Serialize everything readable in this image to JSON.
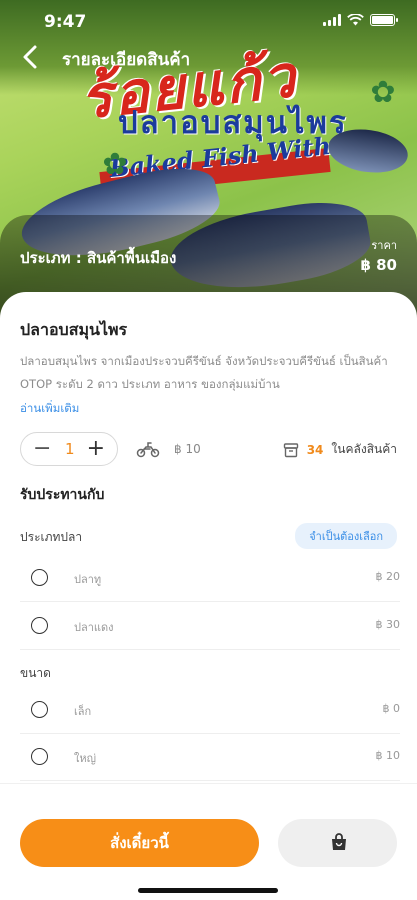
{
  "status_bar": {
    "time": "9:47"
  },
  "nav": {
    "title": "รายละเอียดสินค้า"
  },
  "hero": {
    "brand_text": "ร้อยแก้ว",
    "package_title_th": "ปลาอบสมุนไพร",
    "package_title_en": "Baked Fish With Herbs"
  },
  "category_band": {
    "category": "ประเภท : สินค้าพื้นเมือง",
    "price_label": "ราคา",
    "price": "฿ 80"
  },
  "product": {
    "name": "ปลาอบสมุนไพร",
    "description": "ปลาอบสมุนไพร จากเมืองประจวบคีรีขันธ์ จังหวัดประจวบคีรีขันธ์ เป็นสินค้า OTOP ระดับ 2 ดาว ประเภท อาหาร ของกลุ่มแม่บ้าน",
    "read_more": "อ่านเพิ่มเติม",
    "quantity": "1",
    "delivery_fee": "฿ 10",
    "stock_count": "34",
    "stock_label": "ในคลังสินค้า"
  },
  "options": {
    "section_title": "รับประทานกับ",
    "groups": [
      {
        "label": "ประเภทปลา",
        "badge": "จำเป็นต้องเลือก",
        "items": [
          {
            "name": "ปลาทู",
            "price": "฿ 20"
          },
          {
            "name": "ปลาแดง",
            "price": "฿ 30"
          }
        ]
      },
      {
        "label": "ขนาด",
        "items": [
          {
            "name": "เล็ก",
            "price": "฿ 0"
          },
          {
            "name": "ใหญ่",
            "price": "฿ 10"
          }
        ]
      }
    ]
  },
  "bottom_bar": {
    "order_label": "สั่งเดี๋ยวนี้"
  },
  "colors": {
    "accent": "#f78e17",
    "link": "#3a8ee6"
  }
}
